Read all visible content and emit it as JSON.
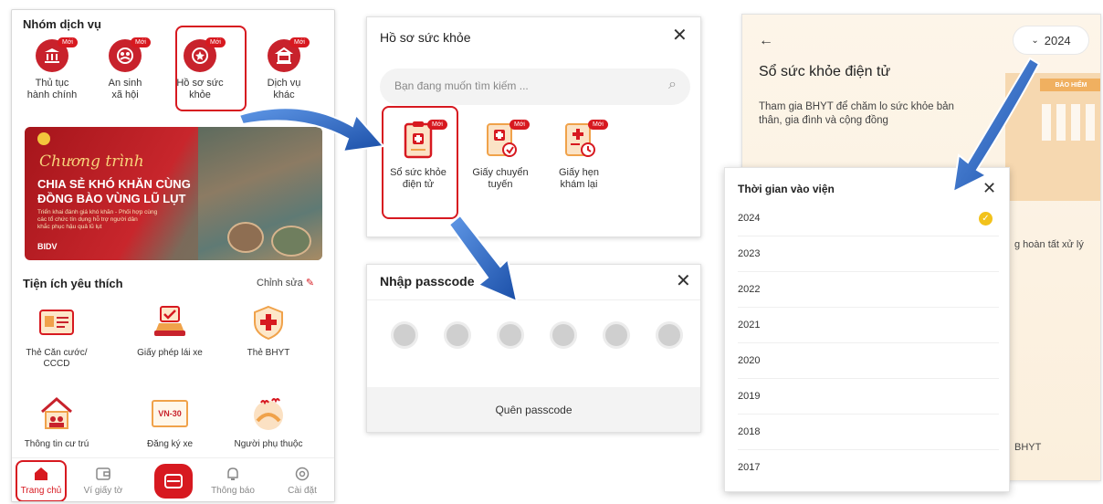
{
  "phone": {
    "section_services": "Nhóm dịch vụ",
    "badge": "Mới",
    "services": [
      {
        "label1": "Thủ tục",
        "label2": "hành chính",
        "icon": "bank-icon"
      },
      {
        "label1": "An sinh",
        "label2": "xã hội",
        "icon": "family-icon"
      },
      {
        "label1": "Hồ sơ sức",
        "label2": "khỏe",
        "icon": "medical-shield-icon"
      },
      {
        "label1": "Dịch vụ",
        "label2": "khác",
        "icon": "services-icon"
      }
    ],
    "banner": {
      "line1": "Chương trình",
      "line2": "CHIA SẺ KHÓ KHĂN CÙNG",
      "line3": "ĐỒNG BÀO VÙNG LŨ LỤT",
      "small1": "Triển khai đánh giá khó khăn - Phối hợp cùng",
      "small2": "các tổ chức tín dụng hỗ trợ người dân",
      "small3": "khắc phục hậu quả lũ lụt",
      "brand": "BIDV"
    },
    "section_favorites": "Tiện ích yêu thích",
    "edit_label": "Chỉnh sửa",
    "favorites": [
      {
        "label1": "Thẻ Căn cước/",
        "label2": "CCCD",
        "icon": "id-card-icon"
      },
      {
        "label1": "Giấy phép lái xe",
        "label2": "",
        "icon": "car-license-icon"
      },
      {
        "label1": "Thẻ BHYT",
        "label2": "",
        "icon": "health-insurance-icon"
      },
      {
        "label1": "Thông tin cư trú",
        "label2": "",
        "icon": "residence-icon"
      },
      {
        "label1": "Đăng ký xe",
        "label2": "",
        "icon": "plate-icon",
        "plate": "VN-30"
      },
      {
        "label1": "Người phụ thuộc",
        "label2": "",
        "icon": "dependents-icon"
      }
    ],
    "tabs": [
      "Trang chủ",
      "Ví giấy tờ",
      "",
      "Thông báo",
      "Cài đặt"
    ]
  },
  "hsk_modal": {
    "title": "Hồ sơ sức khỏe",
    "search_placeholder": "Bạn đang muốn tìm kiếm ...",
    "badge": "Mới",
    "items": [
      {
        "label1": "Sổ sức khỏe",
        "label2": "điện tử"
      },
      {
        "label1": "Giấy chuyển",
        "label2": "tuyến"
      },
      {
        "label1": "Giấy hẹn",
        "label2": "khám lại"
      }
    ]
  },
  "passcode_modal": {
    "title": "Nhập passcode",
    "forgot": "Quên passcode",
    "dot_count": 6
  },
  "health_book": {
    "year_selected": "2024",
    "title": "Sổ sức khỏe điện tử",
    "desc1": "Tham gia BHYT để chăm lo sức khỏe bản",
    "desc2": "thân, gia đình và cộng đồng",
    "building_sign": "BẢO HIỂM",
    "behind_text1": "g hoàn tất xử lý",
    "behind_text2": "BHYT"
  },
  "year_picker": {
    "title": "Thời gian vào viện",
    "years": [
      "2024",
      "2023",
      "2022",
      "2021",
      "2020",
      "2019",
      "2018",
      "2017"
    ],
    "selected_index": 0
  },
  "colors": {
    "brand_red": "#c8222c",
    "accent_blue": "#1b5fbf",
    "check_yellow": "#f2c21b"
  }
}
